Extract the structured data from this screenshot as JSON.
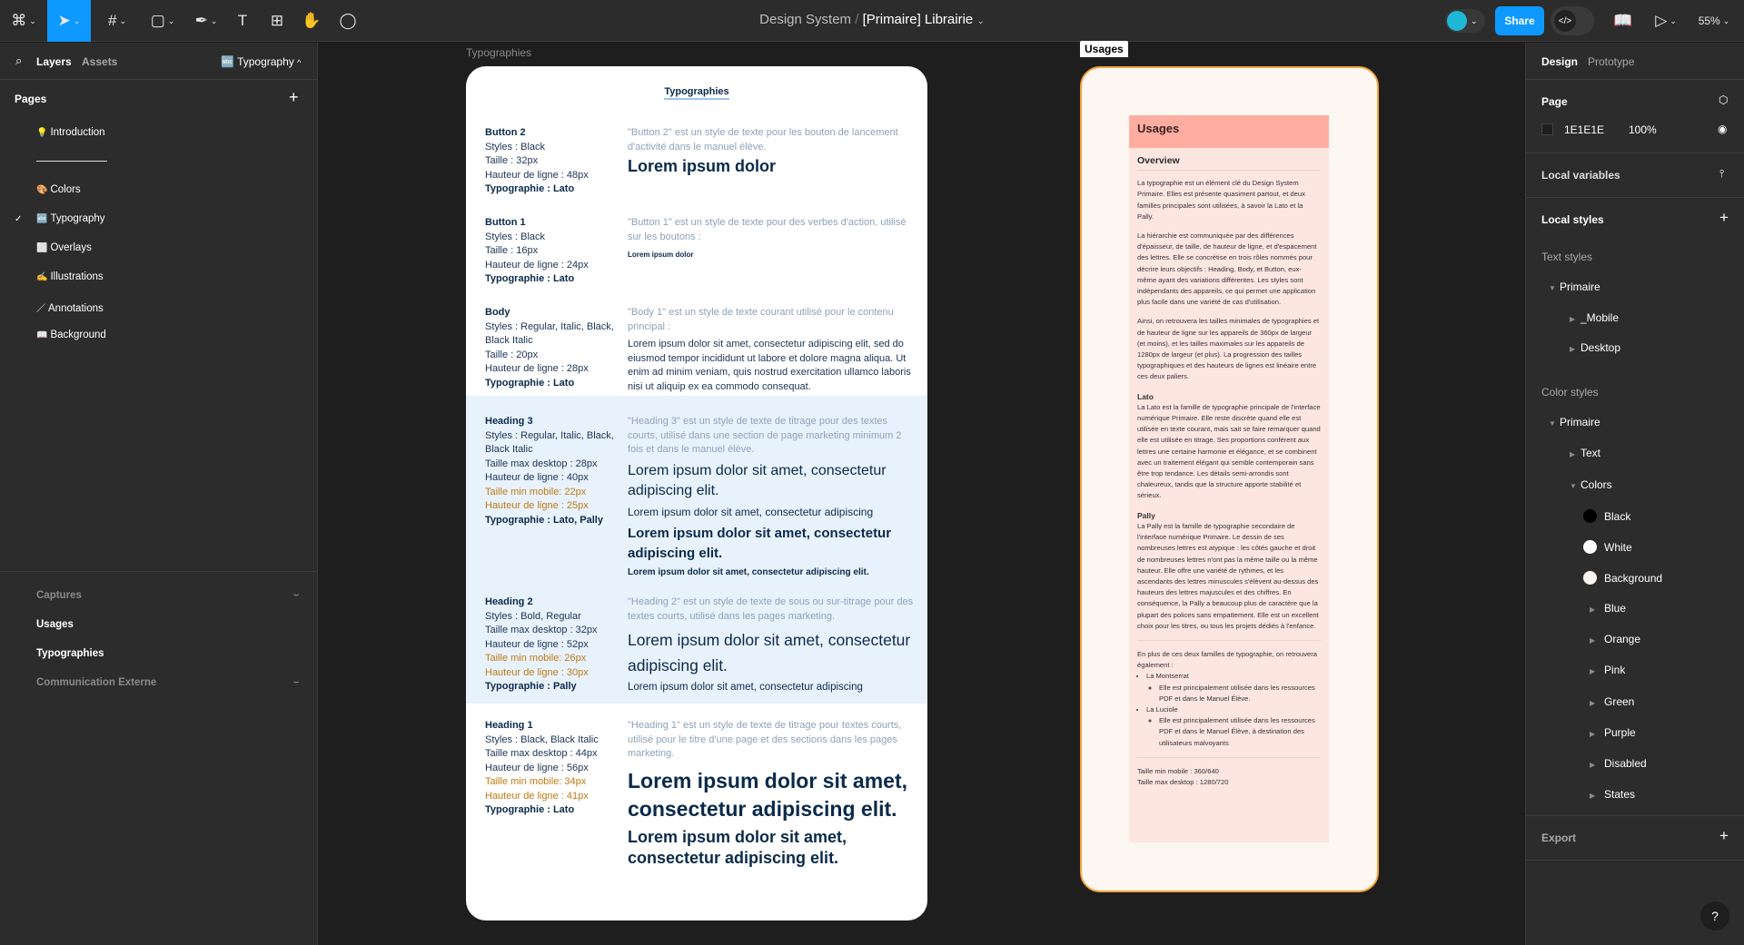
{
  "toolbar": {
    "tools": [
      "figma-menu",
      "move-tool",
      "frame-tool",
      "shape-tool",
      "pen-tool",
      "text-tool",
      "resources-tool",
      "hand-tool",
      "comment-tool"
    ],
    "file_project": "Design System",
    "file_separator": "/",
    "file_name": "[Primaire] Librairie",
    "share_label": "Share",
    "zoom": "55%",
    "accent": "#0d99ff"
  },
  "left_panel": {
    "tab_layers": "Layers",
    "tab_assets": "Assets",
    "current_page": "Typography",
    "pages_title": "Pages",
    "pages": [
      {
        "icon": "💡",
        "label": "Introduction"
      },
      {
        "icon": "",
        "label": "divider"
      },
      {
        "icon": "🎨",
        "label": "Colors"
      },
      {
        "icon": "🔤",
        "label": "Typography",
        "selected": true
      },
      {
        "icon": "⬜",
        "label": "Overlays"
      },
      {
        "icon": "✍️",
        "label": "Illustrations"
      },
      {
        "icon": "／",
        "label": "Annotations"
      },
      {
        "icon": "📖",
        "label": "Background"
      }
    ],
    "layers": [
      {
        "icon": "section-icon",
        "label": "Captures",
        "hidden": true
      },
      {
        "icon": "frame-icon",
        "label": "Usages"
      },
      {
        "icon": "auto-layout-icon",
        "label": "Typographies"
      },
      {
        "icon": "auto-layout-icon",
        "label": "Communication Externe",
        "hidden": true
      }
    ]
  },
  "canvas": {
    "typo_frame_label": "Typographies",
    "usages_frame_label": "Usages",
    "typo": {
      "title": "Typographies",
      "rows": [
        {
          "name": "Button 2",
          "specs": [
            [
              "n",
              "Styles : Black"
            ],
            [
              "n",
              "Taille : 32px"
            ],
            [
              "n",
              "Hauteur de ligne : 48px"
            ],
            [
              "b",
              "Typographie : Lato"
            ]
          ],
          "desc": "\"Button 2\" est un style de texte pour les bouton de lancement d'activité dans le manuel élève.",
          "samples": [
            "Lorem ipsum dolor"
          ]
        },
        {
          "name": "Button 1",
          "specs": [
            [
              "n",
              "Styles : Black"
            ],
            [
              "n",
              "Taille : 16px"
            ],
            [
              "n",
              "Hauteur de ligne : 24px"
            ],
            [
              "b",
              "Typographie : Lato"
            ]
          ],
          "desc": "\"Button 1\" est un style de texte pour des verbes d'action, utilisé sur les boutons :",
          "samples": [
            "Lorem ipsum dolor"
          ]
        },
        {
          "name": "Body",
          "specs": [
            [
              "n",
              "Styles : Regular, Italic, Black, Black Italic"
            ],
            [
              "n",
              "Taille : 20px"
            ],
            [
              "n",
              "Hauteur de ligne : 28px"
            ],
            [
              "b",
              "Typographie : Lato"
            ]
          ],
          "desc": "\"Body 1\" est un style de texte courant utilisé pour le contenu principal :",
          "samples": [
            "Lorem ipsum dolor sit amet, consectetur adipiscing elit, sed do eiusmod tempor incididunt ut labore et dolore magna aliqua. Ut enim ad minim veniam, quis nostrud exercitation ullamco laboris nisi ut aliquip ex ea commodo consequat."
          ]
        },
        {
          "name": "Heading 3",
          "specs": [
            [
              "n",
              "Styles : Regular, Italic, Black, Black Italic"
            ],
            [
              "n",
              "Taille max desktop : 28px"
            ],
            [
              "n",
              "Hauteur de ligne : 40px"
            ],
            [
              "o",
              "Taille min mobile: 22px"
            ],
            [
              "o",
              "Hauteur de ligne : 25px"
            ],
            [
              "b",
              "Typographie : Lato, Pally"
            ]
          ],
          "desc": "\"Heading 3\" est un style de texte de titrage pour des textes courts, utilisé dans une section de page marketing minimum 2 fois et dans le manuel élève.",
          "samples": [
            "Lorem ipsum dolor sit amet, consectetur adipiscing elit.",
            "Lorem ipsum dolor sit amet, consectetur adipiscing",
            "Lorem ipsum dolor sit amet, consectetur adipiscing elit.",
            "Lorem ipsum dolor sit amet, consectetur adipiscing elit."
          ]
        },
        {
          "name": "Heading 2",
          "specs": [
            [
              "n",
              "Styles : Bold, Regular"
            ],
            [
              "n",
              "Taille max desktop : 32px"
            ],
            [
              "n",
              "Hauteur de ligne : 52px"
            ],
            [
              "o",
              "Taille min mobile: 26px"
            ],
            [
              "o",
              "Hauteur de ligne : 30px"
            ],
            [
              "b",
              "Typographie : Pally"
            ]
          ],
          "desc": "\"Heading 2\" est un style de texte de sous ou sur-titrage pour des textes courts, utilisé dans les pages marketing.",
          "samples": [
            "Lorem ipsum dolor sit amet, consectetur adipiscing elit.",
            "Lorem ipsum dolor sit amet, consectetur adipiscing"
          ]
        },
        {
          "name": "Heading 1",
          "specs": [
            [
              "n",
              "Styles : Black, Black Italic"
            ],
            [
              "n",
              "Taille max desktop : 44px"
            ],
            [
              "n",
              "Hauteur de ligne : 56px"
            ],
            [
              "o",
              "Taille min mobile: 34px"
            ],
            [
              "o",
              "Hauteur de ligne : 41px"
            ],
            [
              "b",
              "Typographie : Lato"
            ]
          ],
          "desc": "\"Heading 1\" est un style de texte de titrage pour textes courts, utilisé pour le titre d'une page et des sections dans les pages marketing.",
          "samples": [
            "Lorem ipsum dolor sit amet, consectetur adipiscing elit.",
            "Lorem ipsum dolor sit amet, consectetur adipiscing elit."
          ]
        }
      ]
    },
    "usages": {
      "header": "Usages",
      "overview": "Overview",
      "p1": "La typographie est un élément clé du Design System Primaire. Elles est présente quasiment partout, et deux familles principales sont utilisées, à savoir la Lato et la Pally.",
      "p2": "La hiérarchie est communiquée par des différences d'épaisseur, de taille, de hauteur de ligne, et d'espacement des lettres. Elle se concrétise en trois rôles nommés pour décrire leurs objectifs : Heading, Body, et Button, eux-même ayant des variations différentes. Les styles sont indépendants des appareils, ce qui permet une application plus facile dans une variété de cas d'utilisation.",
      "p3": "Ainsi, on retrouvera les tailles minimales de typographies et de hauteur de ligne sur les appareils de 360px de largeur (et moins), et les tailles maximales sur les appareils de 1280px de largeur (et plus). La progression des tailles typographiques et des hauteurs de lignes est linéaire entre ces deux paliers.",
      "lato_title": "Lato",
      "lato_text": "La Lato est la famille de typographie principale de l'interface numérique Primaire. Elle reste discrète quand elle est utilisée en texte courant, mais sait se faire remarquer quand elle est utilisée en titrage. Ses proportions confèrent aux lettres une certaine harmonie et élégance, et se combinent avec un traitement élégant qui semble contemporain sans être trop tendance. Les détails semi-arrondis sont chaleureux, tandis que la structure apporte stabilité et sérieux.",
      "pally_title": "Pally",
      "pally_text": "La Pally est la famille de typographie secondaire de l'interface numérique Primaire. Le dessin de ses nombreuses lettres est atypique : les côtés gauche et droit de nombreuses lettres n'ont pas la même taille ou la même hauteur. Elle offre une variété de rythmes, et les ascendants des lettres minuscules s'élèvent au-dessus des hauteurs des lettres majuscules et des chiffres. En conséquence, la Pally a beaucoup plus de caractère que la plupart des polices sans empattement. Elle est un excellent choix pour les titres, ou tous les projets dédiés à l'enfance.",
      "more_intro": "En plus de ces deux familles de typographie, on retrouvera également :",
      "montserrat": "La Montserrat",
      "montserrat_note": "Elle est principalement utilisée dans les ressources PDF et dans le Manuel Élève.",
      "luciole": "La Luciole",
      "luciole_note": "Elle est principalement utilisée dans les ressources PDF et dans le Manuel Élève, à destination des utilisateurs malvoyants",
      "min_mobile": "Taille min mobile : 360/640",
      "max_desktop": "Taille max desktop : 1280/720"
    }
  },
  "right_panel": {
    "tab_design": "Design",
    "tab_prototype": "Prototype",
    "page_title": "Page",
    "page_color": "1E1E1E",
    "page_opacity": "100%",
    "local_variables": "Local variables",
    "local_styles": "Local styles",
    "text_styles": "Text styles",
    "text_group": "Primaire",
    "text_items": [
      "_Mobile",
      "Desktop"
    ],
    "color_styles": "Color styles",
    "color_group": "Primaire",
    "color_text": "Text",
    "color_colors": "Colors",
    "swatches": [
      {
        "label": "Black",
        "color": "#000000"
      },
      {
        "label": "White",
        "color": "#ffffff"
      },
      {
        "label": "Background",
        "color": "#fdf7f2"
      }
    ],
    "color_subgroups": [
      "Blue",
      "Orange",
      "Pink",
      "Green",
      "Purple",
      "Disabled",
      "States"
    ],
    "export": "Export",
    "help": "?"
  }
}
